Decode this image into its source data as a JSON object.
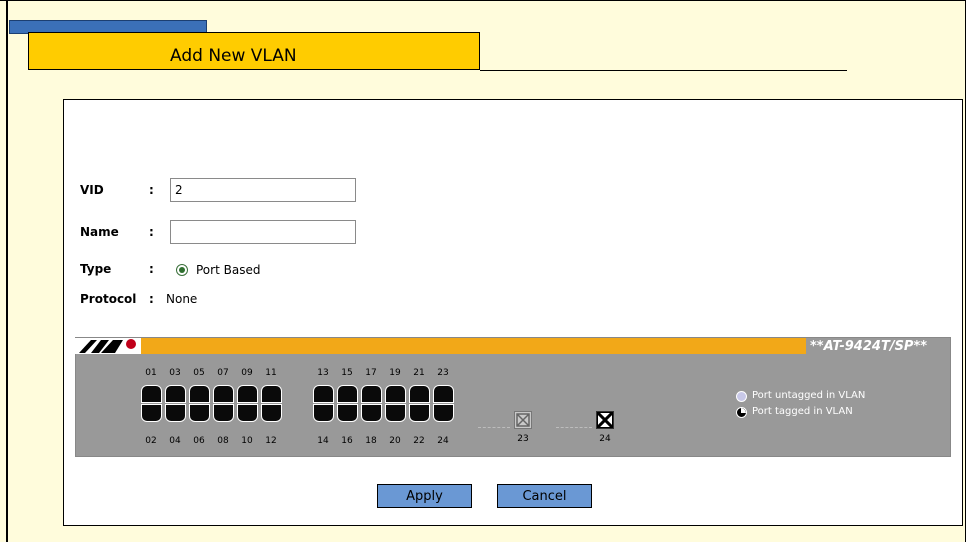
{
  "page": {
    "title": "Add New VLAN"
  },
  "form": {
    "vid_label": "VID",
    "vid_value": "2",
    "name_label": "Name",
    "name_value": "",
    "type_label": "Type",
    "type_option": "Port Based",
    "protocol_label": "Protocol",
    "protocol_value": "None",
    "separator": ":"
  },
  "switch": {
    "model": "**AT-9424T/SP**",
    "top_ports": [
      "01",
      "03",
      "05",
      "07",
      "09",
      "11",
      "13",
      "15",
      "17",
      "19",
      "21",
      "23"
    ],
    "bottom_ports": [
      "02",
      "04",
      "06",
      "08",
      "10",
      "12",
      "14",
      "16",
      "18",
      "20",
      "22",
      "24"
    ],
    "sfp_ports": [
      "23",
      "24"
    ],
    "legend": {
      "untagged": "Port untagged in VLAN",
      "tagged": "Port tagged in VLAN"
    },
    "colors": {
      "bar": "#F2A818",
      "panel": "#999999",
      "port": "#0a0a0a"
    }
  },
  "buttons": {
    "apply": "Apply",
    "cancel": "Cancel"
  },
  "colors": {
    "background": "#FFFCDC",
    "tab_blue": "#3B70B8",
    "tab_yellow": "#FFCC00",
    "button": "#6A98D4"
  }
}
